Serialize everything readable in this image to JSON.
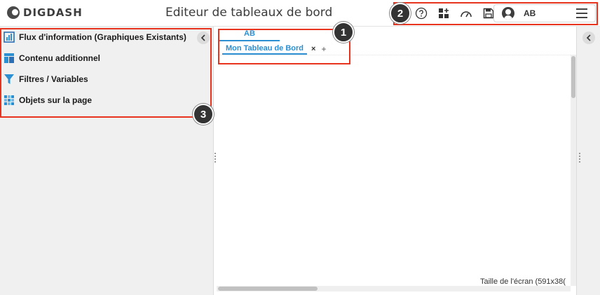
{
  "header": {
    "logo_text": "DIGDASH",
    "title": "Editeur de tableaux de bord",
    "icons": [
      "help-icon",
      "add-widget-icon",
      "gauge-icon",
      "save-icon"
    ],
    "user": {
      "initials": "AB"
    }
  },
  "left_panel": {
    "items": [
      {
        "label": "Flux d'information (Graphiques Existants)",
        "icon": "chart-icon"
      },
      {
        "label": "Contenu additionnel",
        "icon": "layout-icon"
      },
      {
        "label": "Filtres / Variables",
        "icon": "filter-icon"
      },
      {
        "label": "Objets sur la page",
        "icon": "grid-icon"
      }
    ]
  },
  "editor": {
    "role_tab": "AB",
    "page_tab": "Mon Tableau de Bord",
    "close_symbol": "×",
    "add_symbol": "+",
    "screen_size": "Taille de l'écran (591x38("
  },
  "annotations": [
    "1",
    "2",
    "3"
  ],
  "colors": {
    "accent": "#2b8fd1",
    "annotation": "#e8341f",
    "badge": "#333333"
  }
}
